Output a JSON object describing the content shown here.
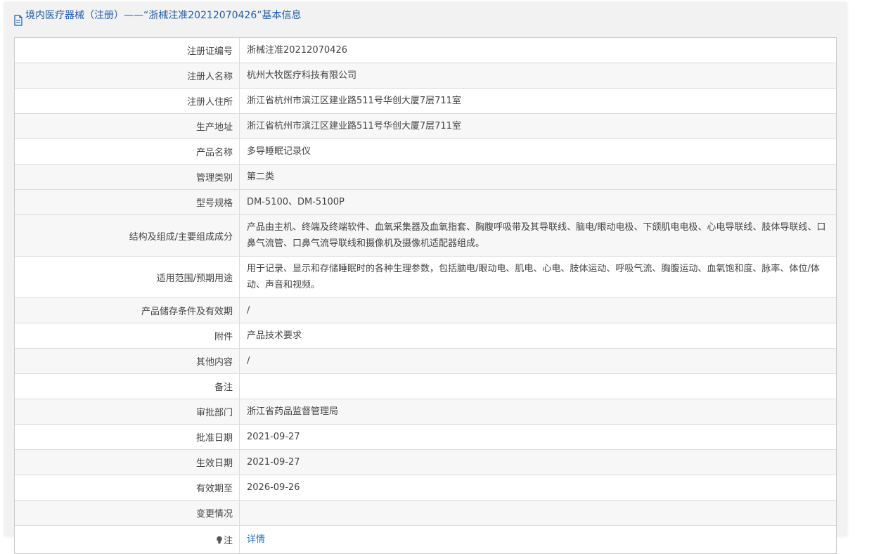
{
  "header": {
    "title": "境内医疗器械（注册）——“浙械注准20212070426”基本信息"
  },
  "rows": [
    {
      "label": "注册证编号",
      "value": "浙械注准20212070426"
    },
    {
      "label": "注册人名称",
      "value": "杭州大牧医疗科技有限公司"
    },
    {
      "label": "注册人住所",
      "value": "浙江省杭州市滨江区建业路511号华创大厦7层711室"
    },
    {
      "label": "生产地址",
      "value": "浙江省杭州市滨江区建业路511号华创大厦7层711室"
    },
    {
      "label": "产品名称",
      "value": "多导睡眠记录仪"
    },
    {
      "label": "管理类别",
      "value": "第二类"
    },
    {
      "label": "型号规格",
      "value": "DM-5100、DM-5100P"
    },
    {
      "label": "结构及组成/主要组成成分",
      "value": "产品由主机、终端及终端软件、血氧采集器及血氧指套、胸腹呼吸带及其导联线、脑电/眼动电极、下颌肌电电极、心电导联线、肢体导联线、口鼻气流管、口鼻气流导联线和摄像机及摄像机适配器组成。"
    },
    {
      "label": "适用范围/预期用途",
      "value": "用于记录、显示和存储睡眠时的各种生理参数，包括脑电/眼动电、肌电、心电、肢体运动、呼吸气流、胸腹运动、血氧饱和度、脉率、体位/体动、声音和视频。"
    },
    {
      "label": "产品储存条件及有效期",
      "value": "/"
    },
    {
      "label": "附件",
      "value": "产品技术要求"
    },
    {
      "label": "其他内容",
      "value": "/"
    },
    {
      "label": "备注",
      "value": ""
    },
    {
      "label": "审批部门",
      "value": "浙江省药品监督管理局"
    },
    {
      "label": "批准日期",
      "value": "2021-09-27"
    },
    {
      "label": "生效日期",
      "value": "2021-09-27"
    },
    {
      "label": "有效期至",
      "value": "2026-09-26"
    },
    {
      "label": "变更情况",
      "value": ""
    }
  ],
  "note": {
    "label": "注",
    "link": "详情"
  },
  "colors": {
    "header_text": "#1f5da5",
    "link": "#2a6fc4"
  }
}
